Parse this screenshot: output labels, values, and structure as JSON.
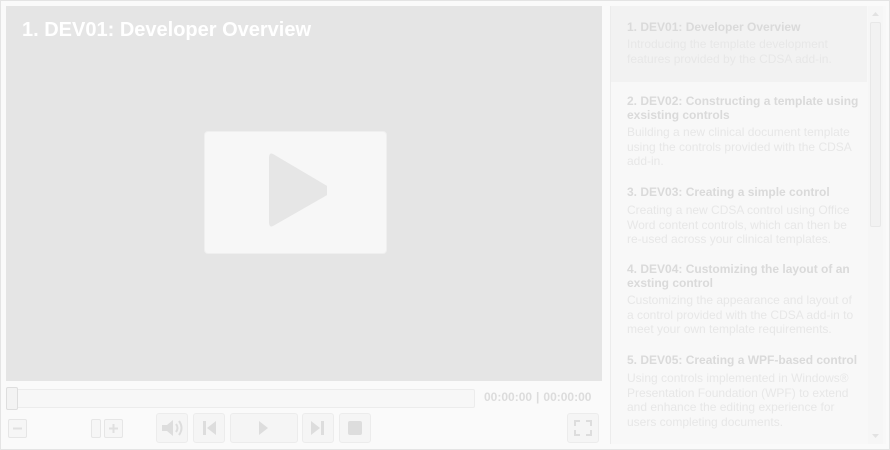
{
  "video": {
    "title": "1. DEV01: Developer Overview",
    "current_time": "00:00:00",
    "separator": "|",
    "duration": "00:00:00",
    "progress": 0
  },
  "controls": {
    "icons": {
      "zoom_out": "minus-icon",
      "zoom_in": "plus-icon",
      "volume": "volume-icon",
      "previous": "skip-previous-icon",
      "play": "play-icon",
      "next": "skip-next-icon",
      "stop": "stop-icon",
      "fullscreen": "fullscreen-icon"
    }
  },
  "playlist": {
    "items": [
      {
        "title": "1. DEV01: Developer Overview",
        "description": "Introducing the template development features provided by the CDSA add-in.",
        "active": true
      },
      {
        "title": "2. DEV02: Constructing a template using exsisting controls",
        "description": "Building a new clinical document template using the controls provided with the CDSA add-in.",
        "active": false
      },
      {
        "title": "3. DEV03: Creating a simple control",
        "description": "Creating a new CDSA control using Office Word content controls, which can then be re-used across your clinical templates.",
        "active": false
      },
      {
        "title": "4. DEV04: Customizing the layout of an exsting control",
        "description": "Customizing the appearance and layout of a control provided with the CDSA add-in to meet your own template requirements.",
        "active": false
      },
      {
        "title": "5. DEV05: Creating a WPF-based control",
        "description": "Using controls implemented in Windows® Presentation Foundation (WPF) to extend and enhance the editing experience for users completing documents.",
        "active": false
      }
    ]
  },
  "colors": {
    "video_background": "#e5e5e5",
    "panel_background": "#f8f8f8",
    "text_faded": "#dadada"
  }
}
